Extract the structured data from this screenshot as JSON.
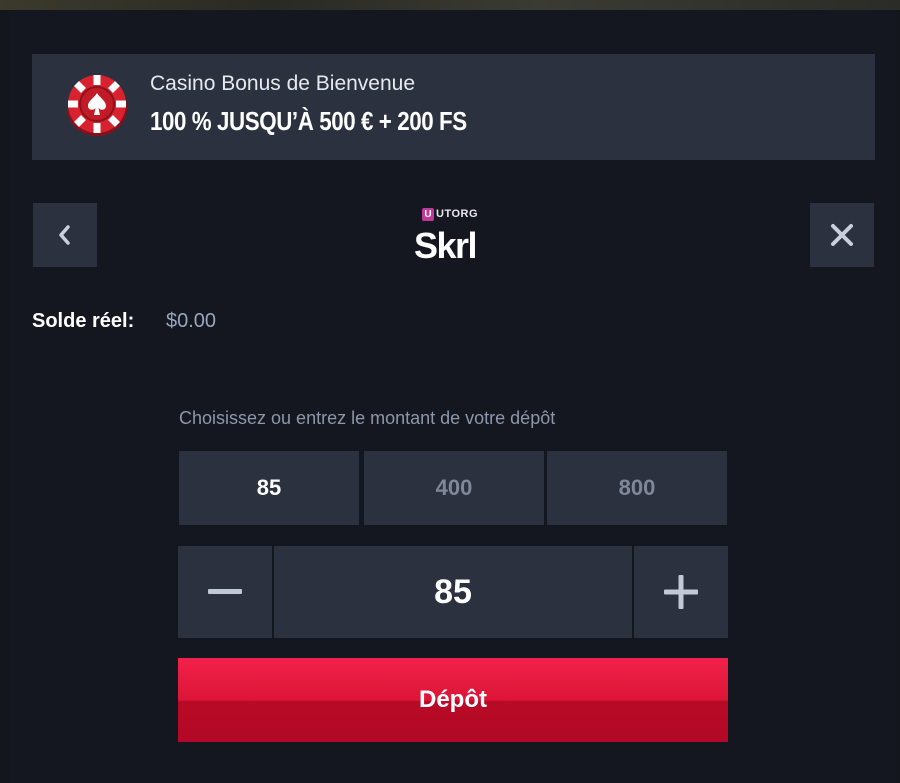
{
  "bonus": {
    "title": "Casino Bonus de Bienvenue",
    "offer": "100 % JUSQU’À 500 € + 200 FS",
    "icon": "poker-chip-icon"
  },
  "header": {
    "back_icon": "chevron-left-icon",
    "close_icon": "close-icon",
    "provider_badge": "U",
    "provider_name": "UTORG",
    "method_name": "Skrl"
  },
  "balance": {
    "label": "Solde réel:",
    "value": "$0.00"
  },
  "deposit": {
    "hint": "Choisissez ou entrez le montant de votre dépôt",
    "options": [
      "85",
      "400",
      "800"
    ],
    "selected_option": "85",
    "amount_value": "85",
    "minus_icon": "minus-icon",
    "plus_icon": "plus-icon",
    "submit_label": "Dépôt"
  },
  "colors": {
    "background": "#14161d",
    "panel": "#2b313e",
    "accent": "#e5183c",
    "muted_text": "#8d97aa"
  }
}
